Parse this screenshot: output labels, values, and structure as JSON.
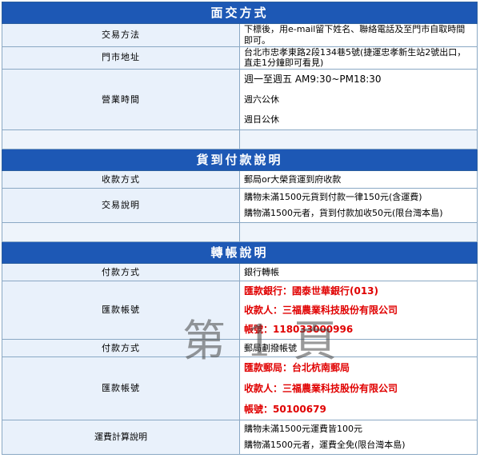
{
  "sections": {
    "meet": {
      "title": "面交方式",
      "trade_label": "交易方法",
      "trade_text": "下標後，用e-mail留下姓名、聯絡電話及至門市自取時間即可。",
      "address_label": "門市地址",
      "address_text": "台北市忠孝東路2段134巷5號(捷運忠孝新生站2號出口，直走1分鐘即可看見)",
      "hours_label": "營業時間",
      "hours_lines": [
        "週一至週五 AM9:30~PM18:30",
        "週六公休",
        "週日公休"
      ]
    },
    "cod": {
      "title": "貨到付款說明",
      "collect_label": "收款方式",
      "collect_text": "郵局or大榮貨運到府收款",
      "explain_label": "交易說明",
      "explain_lines": [
        "購物未滿1500元貨到付款一律150元(含運費)",
        "購物滿1500元者，貨到付款加收50元(限台灣本島)"
      ]
    },
    "transfer": {
      "title": "轉帳說明",
      "pay_label_1": "付款方式",
      "pay_text_1": "銀行轉帳",
      "account_label_1": "匯款帳號",
      "bank_lines": [
        "匯款銀行：國泰世華銀行(013)",
        "收款人：三福農業科技股份有限公司",
        "帳號：118033000996"
      ],
      "pay_label_2": "付款方式",
      "pay_text_2": "郵局劃撥帳號",
      "account_label_2": "匯款帳號",
      "post_lines": [
        "匯款郵局：台北杭南郵局",
        "收款人：三福農業科技股份有限公司",
        "帳號：50100679"
      ],
      "shipping_label": "運費計算說明",
      "shipping_lines": [
        "購物未滿1500元運費皆100元",
        "購物滿1500元者，運費全免(限台灣本島)"
      ]
    }
  },
  "watermark": "第 1 頁",
  "colors": {
    "header_bg": "#1d58b5",
    "label_bg": "#e9f1fb",
    "border": "#8aa8c4",
    "highlight": "#e00000"
  }
}
